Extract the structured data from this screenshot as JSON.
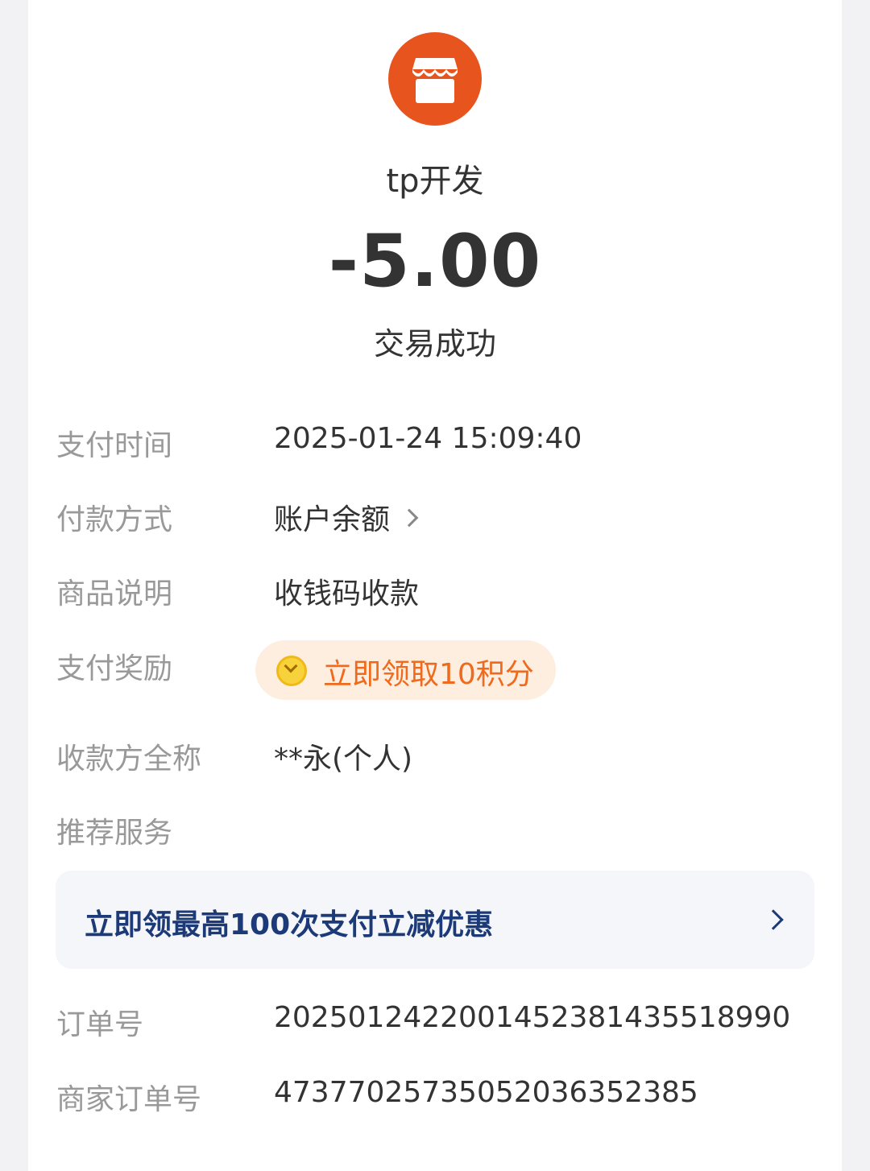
{
  "header": {
    "merchant_name": "tp开发",
    "amount": "-5.00",
    "status": "交易成功",
    "logo_icon": "store-icon",
    "logo_color": "#e8541e"
  },
  "details": {
    "pay_time": {
      "label": "支付时间",
      "value": "2025-01-24 15:09:40"
    },
    "pay_method": {
      "label": "付款方式",
      "value": "账户余额"
    },
    "product_desc": {
      "label": "商品说明",
      "value": "收钱码收款"
    },
    "reward": {
      "label": "支付奖励",
      "value": "立即领取10积分",
      "icon": "coin-icon"
    },
    "payee": {
      "label": "收款方全称",
      "value": "**永(个人)"
    },
    "recommend": {
      "label": "推荐服务"
    },
    "order_no": {
      "label": "订单号",
      "value": "2025012422001452381435518990"
    },
    "merchant_order_no": {
      "label": "商家订单号",
      "value": "473770257350520363523 85"
    }
  },
  "promo": {
    "text": "立即领最高100次支付立减优惠"
  },
  "colors": {
    "accent_orange": "#ef6a1c",
    "promo_blue": "#1d3a78",
    "label_gray": "#999999"
  }
}
